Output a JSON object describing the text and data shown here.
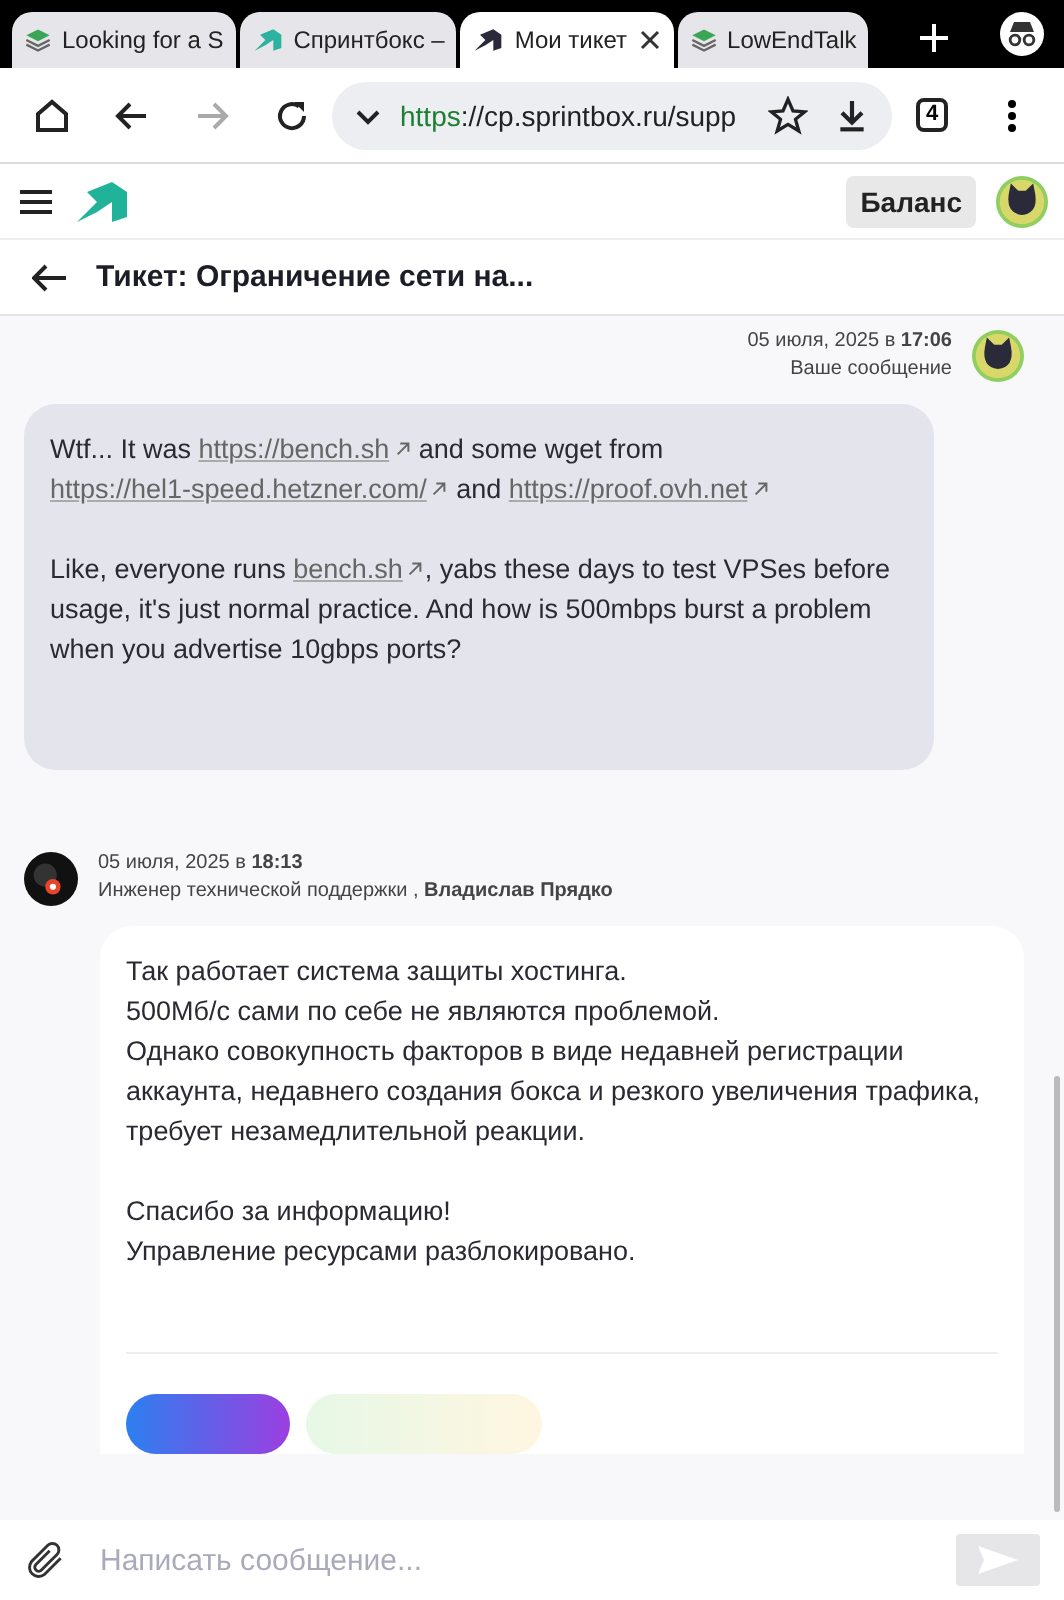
{
  "browser": {
    "tabs": [
      {
        "label": "Looking for a S",
        "selected": false,
        "kind": "layers"
      },
      {
        "label": "Спринтбокс –",
        "selected": false,
        "kind": "logo"
      },
      {
        "label": "Мои тикет",
        "selected": true,
        "kind": "logo"
      },
      {
        "label": "LowEndTalk",
        "selected": false,
        "kind": "layers"
      }
    ],
    "url_scheme": "https",
    "url_rest": "://cp.sprintbox.ru/supp",
    "tab_count": "4"
  },
  "header": {
    "balance_button": "Баланс"
  },
  "ticket": {
    "title": "Тикет: Ограничение сети на..."
  },
  "messages": [
    {
      "kind": "user",
      "date": "05 июля, 2025 в **17:06**",
      "meta": "Ваше сообщение",
      "paragraphs": [
        [
          {
            "kind": "text",
            "text": "Wtf... It was "
          },
          {
            "kind": "link",
            "text": "https://bench.sh"
          },
          {
            "kind": "text",
            "text": " and some wget from "
          },
          {
            "kind": "link",
            "text": "https://hel1-speed.hetzner.com/"
          },
          {
            "kind": "text",
            "text": " and "
          },
          {
            "kind": "link",
            "text": "https://proof.ovh.net"
          }
        ],
        [
          {
            "kind": "text",
            "text": "Like, everyone runs "
          },
          {
            "kind": "link",
            "text": "bench.sh"
          },
          {
            "kind": "text",
            "text": ", yabs these days to test VPSes before usage, it's just normal practice. And how is 500mbps burst a problem when you advertise 10gbps ports?"
          }
        ]
      ]
    },
    {
      "kind": "support",
      "date": "05 июля, 2025 в **18:13**",
      "meta": "Инженер технической поддержки , **Владислав Прядко**",
      "paragraphs": [
        [
          {
            "kind": "text",
            "text": "Так работает система защиты хостинга.\n500Мб/с сами по себе не являются проблемой.\nОднако совокупность факторов в виде недавней регистрации аккаунта, недавнего создания бокса и резкого увеличения трафика, требует незамедлительной реакции."
          }
        ],
        [
          {
            "kind": "text",
            "text": "Спасибо за информацию!\nУправление ресурсами разблокировано."
          }
        ]
      ]
    }
  ],
  "composer": {
    "placeholder": "Написать сообщение..."
  }
}
